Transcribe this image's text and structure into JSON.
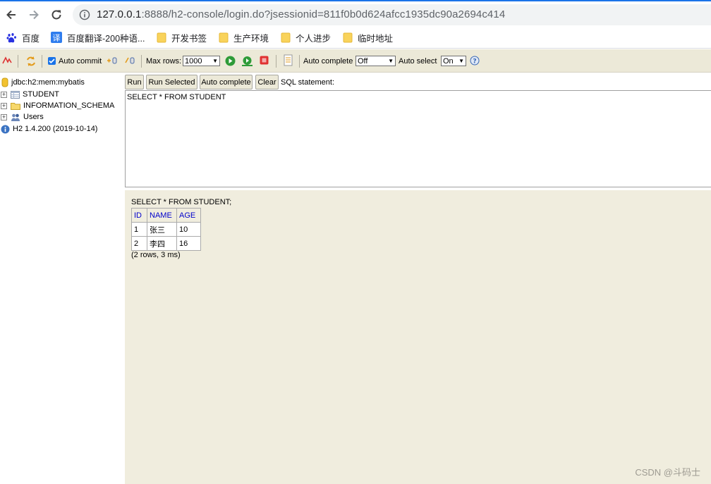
{
  "browser": {
    "url_host": "127.0.0.1",
    "url_rest": ":8888/h2-console/login.do?jsessionid=811f0b0d624afcc1935dc90a2694c414",
    "bookmarks": [
      {
        "label": "百度",
        "icon": "baidu-icon"
      },
      {
        "label": "百度翻译-200种语...",
        "icon": "translate-icon"
      },
      {
        "label": "开发书签",
        "icon": "folder-icon"
      },
      {
        "label": "生产环境",
        "icon": "folder-icon"
      },
      {
        "label": "个人进步",
        "icon": "folder-icon"
      },
      {
        "label": "临时地址",
        "icon": "folder-icon"
      }
    ]
  },
  "toolbar": {
    "auto_commit_label": "Auto commit",
    "auto_commit_checked": true,
    "max_rows_label": "Max rows:",
    "max_rows_value": "1000",
    "auto_complete_label": "Auto complete",
    "auto_complete_value": "Off",
    "auto_select_label": "Auto select",
    "auto_select_value": "On"
  },
  "tree": {
    "connection": "jdbc:h2:mem:mybatis",
    "items": [
      "STUDENT",
      "INFORMATION_SCHEMA",
      "Users"
    ],
    "version": "H2 1.4.200 (2019-10-14)"
  },
  "query": {
    "run": "Run",
    "run_selected": "Run Selected",
    "auto_complete": "Auto complete",
    "clear": "Clear",
    "sql_label": "SQL statement:",
    "sql_text": "SELECT * FROM STUDENT"
  },
  "results": {
    "statement": "SELECT * FROM STUDENT;",
    "columns": [
      "ID",
      "NAME",
      "AGE"
    ],
    "rows": [
      [
        "1",
        "张三",
        "10"
      ],
      [
        "2",
        "李四",
        "16"
      ]
    ],
    "summary": "(2 rows, 3 ms)"
  },
  "watermark": "CSDN @斗码士",
  "colors": {
    "accent": "#1a73e8",
    "panel": "#ece9d8",
    "result_bg": "#f0edde",
    "header_link": "#0000cc"
  }
}
